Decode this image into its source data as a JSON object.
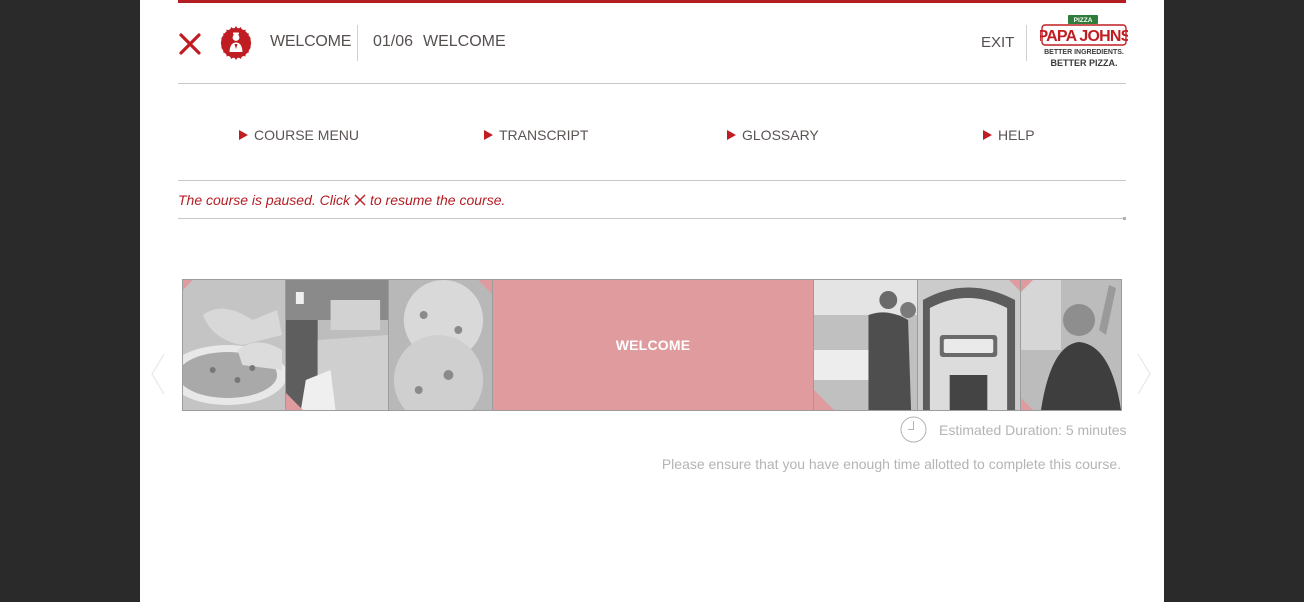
{
  "header": {
    "title": "WELCOME",
    "progress": "01/06",
    "lesson": "WELCOME",
    "exit_label": "EXIT"
  },
  "logo": {
    "badge": "PIZZA",
    "brand": "PAPA JOHNS",
    "tagline_1": "BETTER INGREDIENTS.",
    "tagline_2": "BETTER PIZZA."
  },
  "menu": {
    "items": [
      {
        "label": "COURSE MENU"
      },
      {
        "label": "TRANSCRIPT"
      },
      {
        "label": "GLOSSARY"
      },
      {
        "label": "HELP"
      }
    ]
  },
  "pause": {
    "before": "The course is paused. Click",
    "after": "to resume the course."
  },
  "carousel": {
    "current_label": "WELCOME"
  },
  "info": {
    "duration": "Estimated Duration: 5 minutes",
    "note": "Please ensure that you have enough time allotted to complete this course."
  },
  "colors": {
    "accent": "#b41e23",
    "tile_highlight": "#e09b9e",
    "backdrop": "#2a2a2a"
  }
}
